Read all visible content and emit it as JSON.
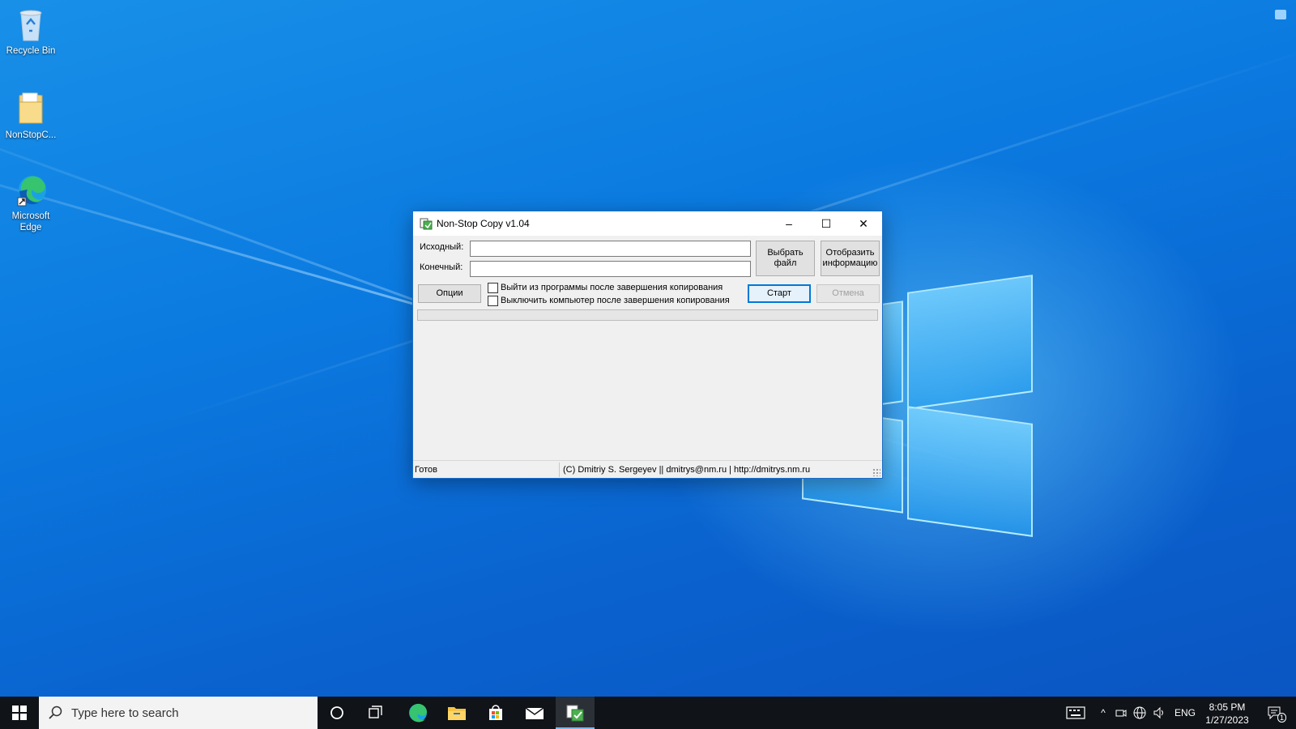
{
  "desktop": {
    "icons": [
      {
        "label": "Recycle Bin",
        "icon": "recycle-bin-icon"
      },
      {
        "label": "NonStopC...",
        "icon": "folder-icon"
      },
      {
        "label": "Microsoft Edge",
        "icon": "edge-icon"
      }
    ]
  },
  "window": {
    "title": "Non-Stop Copy v1.04",
    "controls": {
      "minimize": "–",
      "maximize": "☐",
      "close": "✕"
    },
    "source_label": "Исходный:",
    "source_value": "",
    "dest_label": "Конечный:",
    "dest_value": "",
    "choose_file_button": "Выбрать файл",
    "show_info_button": "Отобразить информацию",
    "options_button": "Опции",
    "checkbox_exit": {
      "label": "Выйти из программы после завершения копирования",
      "checked": false
    },
    "checkbox_shutdown": {
      "label": "Выключить компьютер после завершения копирования",
      "checked": false
    },
    "start_button": "Старт",
    "cancel_button": "Отмена",
    "progress": 0,
    "status_left": "Готов",
    "status_right": "(C) Dmitriy S. Sergeyev || dmitrys@nm.ru | http://dmitrys.nm.ru"
  },
  "taskbar": {
    "search_placeholder": "Type here to search",
    "pinned": [
      "cortana-icon",
      "task-view-icon",
      "edge-icon",
      "file-explorer-icon",
      "store-icon",
      "mail-icon",
      "nonstopcopy-icon"
    ],
    "active": "nonstopcopy-icon",
    "tray": {
      "language": "ENG",
      "time": "8:05 PM",
      "date": "1/27/2023",
      "notification_count": "1"
    }
  },
  "colors": {
    "accent": "#0078d7",
    "taskbar": "#101317",
    "window_border": "#1b6ec9"
  }
}
